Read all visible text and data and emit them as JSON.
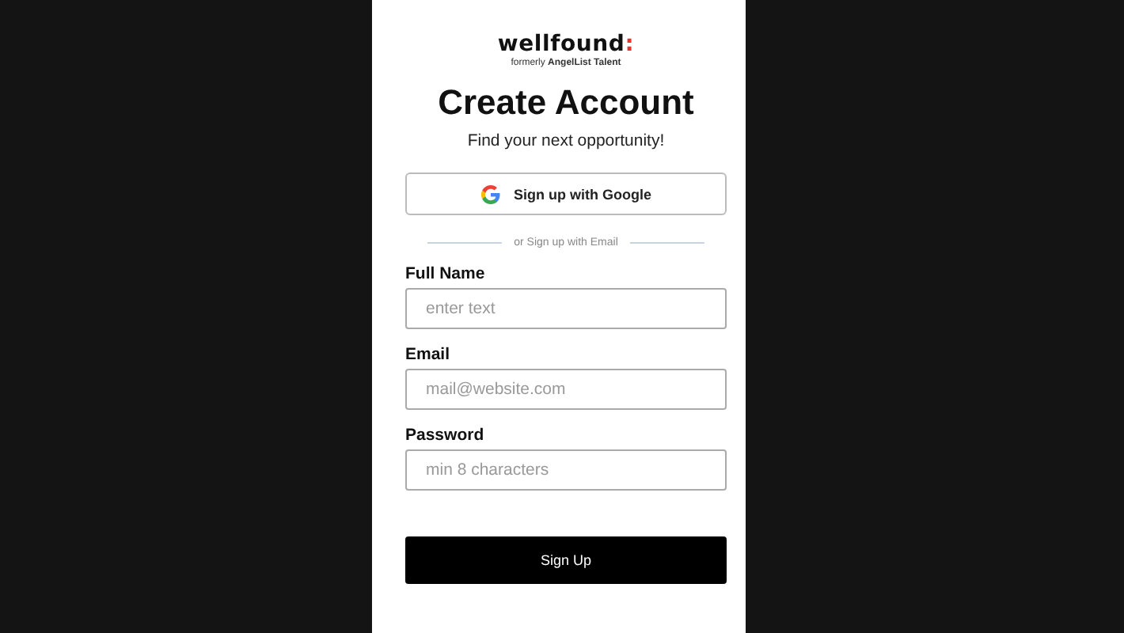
{
  "logo": {
    "name": "wellfound",
    "mark": ":",
    "tagline": "formerly **AngelList Talent**"
  },
  "title": "Create Account",
  "subtitle": "Find your next opportunity!",
  "google_button": "Sign up with Google",
  "divider": "or Sign up with Email",
  "fields": [
    {
      "label": "Full Name",
      "placeholder": "enter text"
    },
    {
      "label": "Email",
      "placeholder": "mail@website.com"
    },
    {
      "label": "Password",
      "placeholder": "min 8 characters"
    }
  ],
  "submit_button": "Sign Up"
}
